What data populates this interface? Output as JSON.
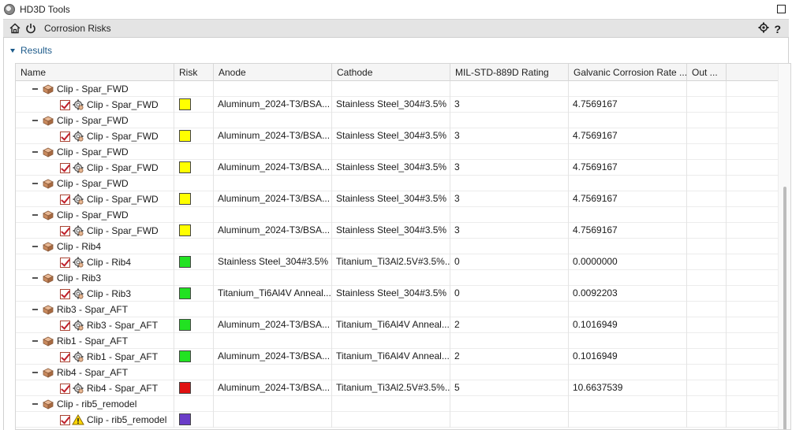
{
  "window": {
    "title": "HD3D Tools"
  },
  "toolbar": {
    "title": "Corrosion Risks"
  },
  "section": {
    "label": "Results"
  },
  "columns": [
    "Name",
    "Risk",
    "Anode",
    "Cathode",
    "MIL-STD-889D Rating",
    "Galvanic Corrosion Rate ...",
    "Out ...",
    ""
  ],
  "colors": {
    "yellow": "#ffff00",
    "green": "#22e222",
    "red": "#e01010",
    "purple": "#6a3cc8"
  },
  "rows": [
    {
      "type": "parent",
      "name": "Clip - Spar_FWD"
    },
    {
      "type": "child",
      "name": "Clip - Spar_FWD",
      "risk": "yellow",
      "anode": "Aluminum_2024-T3/BSA...",
      "cathode": "Stainless Steel_304#3.5% ...",
      "rating": "3",
      "rate": "4.7569167",
      "warn": false
    },
    {
      "type": "parent",
      "name": "Clip - Spar_FWD"
    },
    {
      "type": "child",
      "name": "Clip - Spar_FWD",
      "risk": "yellow",
      "anode": "Aluminum_2024-T3/BSA...",
      "cathode": "Stainless Steel_304#3.5% ...",
      "rating": "3",
      "rate": "4.7569167",
      "warn": false
    },
    {
      "type": "parent",
      "name": "Clip - Spar_FWD"
    },
    {
      "type": "child",
      "name": "Clip - Spar_FWD",
      "risk": "yellow",
      "anode": "Aluminum_2024-T3/BSA...",
      "cathode": "Stainless Steel_304#3.5% ...",
      "rating": "3",
      "rate": "4.7569167",
      "warn": false
    },
    {
      "type": "parent",
      "name": "Clip - Spar_FWD"
    },
    {
      "type": "child",
      "name": "Clip - Spar_FWD",
      "risk": "yellow",
      "anode": "Aluminum_2024-T3/BSA...",
      "cathode": "Stainless Steel_304#3.5% ...",
      "rating": "3",
      "rate": "4.7569167",
      "warn": false
    },
    {
      "type": "parent",
      "name": "Clip - Spar_FWD"
    },
    {
      "type": "child",
      "name": "Clip - Spar_FWD",
      "risk": "yellow",
      "anode": "Aluminum_2024-T3/BSA...",
      "cathode": "Stainless Steel_304#3.5% ...",
      "rating": "3",
      "rate": "4.7569167",
      "warn": false
    },
    {
      "type": "parent",
      "name": "Clip - Rib4"
    },
    {
      "type": "child",
      "name": "Clip - Rib4",
      "risk": "green",
      "anode": "Stainless Steel_304#3.5% ...",
      "cathode": "Titanium_Ti3Al2.5V#3.5%...",
      "rating": "0",
      "rate": "0.0000000",
      "warn": false
    },
    {
      "type": "parent",
      "name": "Clip - Rib3"
    },
    {
      "type": "child",
      "name": "Clip - Rib3",
      "risk": "green",
      "anode": "Titanium_Ti6Al4V Anneal...",
      "cathode": "Stainless Steel_304#3.5% ...",
      "rating": "0",
      "rate": "0.0092203",
      "warn": false
    },
    {
      "type": "parent",
      "name": "Rib3 - Spar_AFT"
    },
    {
      "type": "child",
      "name": "Rib3 - Spar_AFT",
      "risk": "green",
      "anode": "Aluminum_2024-T3/BSA...",
      "cathode": "Titanium_Ti6Al4V Anneal...",
      "rating": "2",
      "rate": "0.1016949",
      "warn": false
    },
    {
      "type": "parent",
      "name": "Rib1 - Spar_AFT"
    },
    {
      "type": "child",
      "name": "Rib1 - Spar_AFT",
      "risk": "green",
      "anode": "Aluminum_2024-T3/BSA...",
      "cathode": "Titanium_Ti6Al4V Anneal...",
      "rating": "2",
      "rate": "0.1016949",
      "warn": false
    },
    {
      "type": "parent",
      "name": "Rib4 - Spar_AFT"
    },
    {
      "type": "child",
      "name": "Rib4 - Spar_AFT",
      "risk": "red",
      "anode": "Aluminum_2024-T3/BSA...",
      "cathode": "Titanium_Ti3Al2.5V#3.5%...",
      "rating": "5",
      "rate": "10.6637539",
      "warn": false
    },
    {
      "type": "parent",
      "name": "Clip - rib5_remodel"
    },
    {
      "type": "child",
      "name": "Clip - rib5_remodel",
      "risk": "purple",
      "anode": "",
      "cathode": "",
      "rating": "",
      "rate": "",
      "warn": true
    }
  ]
}
